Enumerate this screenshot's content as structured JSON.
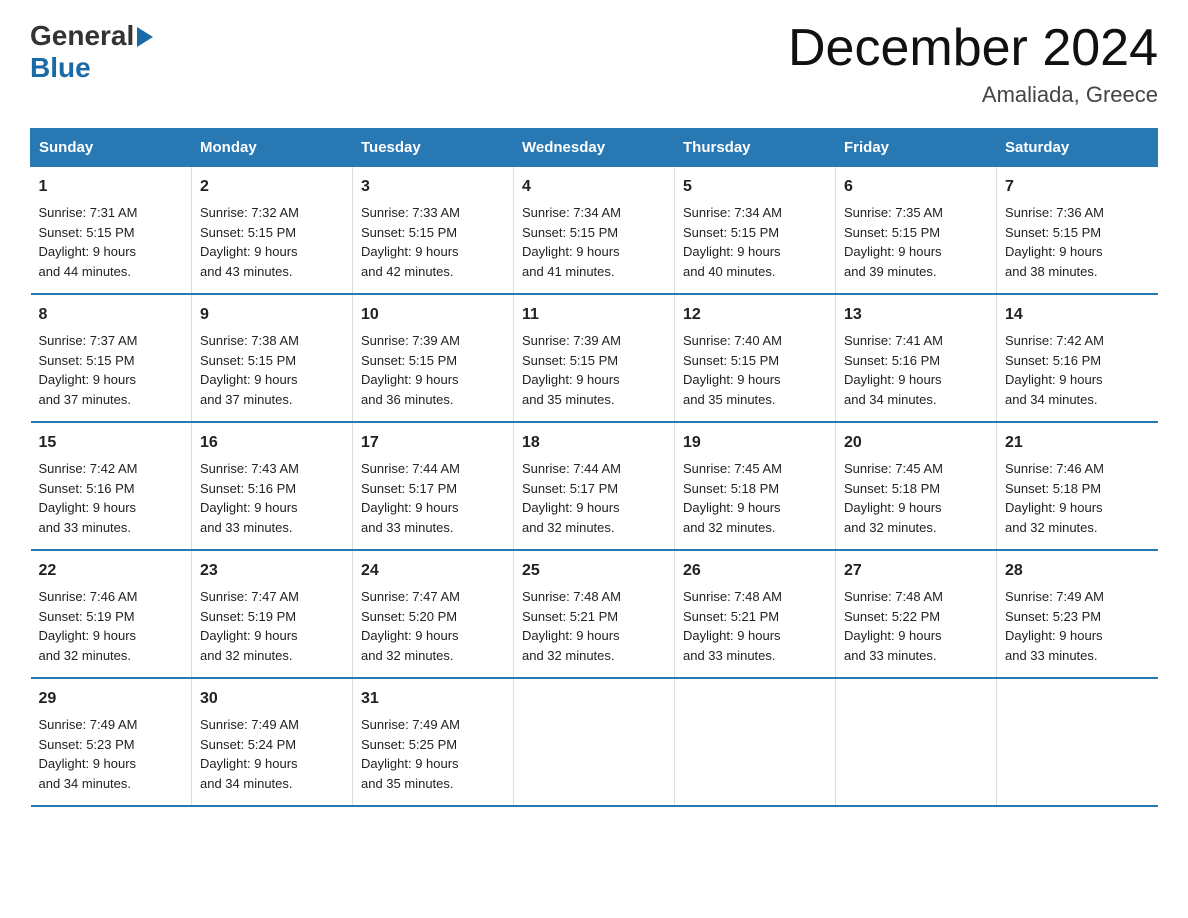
{
  "header": {
    "logo_general": "General",
    "logo_blue": "Blue",
    "title": "December 2024",
    "subtitle": "Amaliada, Greece"
  },
  "days_of_week": [
    "Sunday",
    "Monday",
    "Tuesday",
    "Wednesday",
    "Thursday",
    "Friday",
    "Saturday"
  ],
  "weeks": [
    [
      {
        "day": "1",
        "sunrise": "7:31 AM",
        "sunset": "5:15 PM",
        "daylight": "9 hours and 44 minutes."
      },
      {
        "day": "2",
        "sunrise": "7:32 AM",
        "sunset": "5:15 PM",
        "daylight": "9 hours and 43 minutes."
      },
      {
        "day": "3",
        "sunrise": "7:33 AM",
        "sunset": "5:15 PM",
        "daylight": "9 hours and 42 minutes."
      },
      {
        "day": "4",
        "sunrise": "7:34 AM",
        "sunset": "5:15 PM",
        "daylight": "9 hours and 41 minutes."
      },
      {
        "day": "5",
        "sunrise": "7:34 AM",
        "sunset": "5:15 PM",
        "daylight": "9 hours and 40 minutes."
      },
      {
        "day": "6",
        "sunrise": "7:35 AM",
        "sunset": "5:15 PM",
        "daylight": "9 hours and 39 minutes."
      },
      {
        "day": "7",
        "sunrise": "7:36 AM",
        "sunset": "5:15 PM",
        "daylight": "9 hours and 38 minutes."
      }
    ],
    [
      {
        "day": "8",
        "sunrise": "7:37 AM",
        "sunset": "5:15 PM",
        "daylight": "9 hours and 37 minutes."
      },
      {
        "day": "9",
        "sunrise": "7:38 AM",
        "sunset": "5:15 PM",
        "daylight": "9 hours and 37 minutes."
      },
      {
        "day": "10",
        "sunrise": "7:39 AM",
        "sunset": "5:15 PM",
        "daylight": "9 hours and 36 minutes."
      },
      {
        "day": "11",
        "sunrise": "7:39 AM",
        "sunset": "5:15 PM",
        "daylight": "9 hours and 35 minutes."
      },
      {
        "day": "12",
        "sunrise": "7:40 AM",
        "sunset": "5:15 PM",
        "daylight": "9 hours and 35 minutes."
      },
      {
        "day": "13",
        "sunrise": "7:41 AM",
        "sunset": "5:16 PM",
        "daylight": "9 hours and 34 minutes."
      },
      {
        "day": "14",
        "sunrise": "7:42 AM",
        "sunset": "5:16 PM",
        "daylight": "9 hours and 34 minutes."
      }
    ],
    [
      {
        "day": "15",
        "sunrise": "7:42 AM",
        "sunset": "5:16 PM",
        "daylight": "9 hours and 33 minutes."
      },
      {
        "day": "16",
        "sunrise": "7:43 AM",
        "sunset": "5:16 PM",
        "daylight": "9 hours and 33 minutes."
      },
      {
        "day": "17",
        "sunrise": "7:44 AM",
        "sunset": "5:17 PM",
        "daylight": "9 hours and 33 minutes."
      },
      {
        "day": "18",
        "sunrise": "7:44 AM",
        "sunset": "5:17 PM",
        "daylight": "9 hours and 32 minutes."
      },
      {
        "day": "19",
        "sunrise": "7:45 AM",
        "sunset": "5:18 PM",
        "daylight": "9 hours and 32 minutes."
      },
      {
        "day": "20",
        "sunrise": "7:45 AM",
        "sunset": "5:18 PM",
        "daylight": "9 hours and 32 minutes."
      },
      {
        "day": "21",
        "sunrise": "7:46 AM",
        "sunset": "5:18 PM",
        "daylight": "9 hours and 32 minutes."
      }
    ],
    [
      {
        "day": "22",
        "sunrise": "7:46 AM",
        "sunset": "5:19 PM",
        "daylight": "9 hours and 32 minutes."
      },
      {
        "day": "23",
        "sunrise": "7:47 AM",
        "sunset": "5:19 PM",
        "daylight": "9 hours and 32 minutes."
      },
      {
        "day": "24",
        "sunrise": "7:47 AM",
        "sunset": "5:20 PM",
        "daylight": "9 hours and 32 minutes."
      },
      {
        "day": "25",
        "sunrise": "7:48 AM",
        "sunset": "5:21 PM",
        "daylight": "9 hours and 32 minutes."
      },
      {
        "day": "26",
        "sunrise": "7:48 AM",
        "sunset": "5:21 PM",
        "daylight": "9 hours and 33 minutes."
      },
      {
        "day": "27",
        "sunrise": "7:48 AM",
        "sunset": "5:22 PM",
        "daylight": "9 hours and 33 minutes."
      },
      {
        "day": "28",
        "sunrise": "7:49 AM",
        "sunset": "5:23 PM",
        "daylight": "9 hours and 33 minutes."
      }
    ],
    [
      {
        "day": "29",
        "sunrise": "7:49 AM",
        "sunset": "5:23 PM",
        "daylight": "9 hours and 34 minutes."
      },
      {
        "day": "30",
        "sunrise": "7:49 AM",
        "sunset": "5:24 PM",
        "daylight": "9 hours and 34 minutes."
      },
      {
        "day": "31",
        "sunrise": "7:49 AM",
        "sunset": "5:25 PM",
        "daylight": "9 hours and 35 minutes."
      },
      null,
      null,
      null,
      null
    ]
  ],
  "labels": {
    "sunrise": "Sunrise:",
    "sunset": "Sunset:",
    "daylight": "Daylight:"
  },
  "colors": {
    "header_bg": "#2878b4",
    "header_text": "#ffffff",
    "row_border": "#2878b4"
  }
}
